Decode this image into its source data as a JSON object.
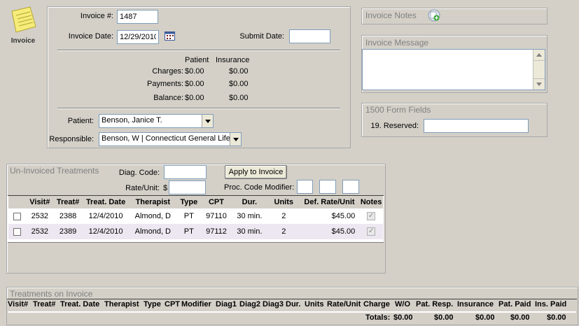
{
  "nav": {
    "invoice_label": "Invoice"
  },
  "invoice": {
    "number_label": "Invoice #:",
    "number_value": "1487",
    "date_label": "Invoice Date:",
    "date_value": "12/29/2010",
    "submit_label": "Submit Date:",
    "submit_value": ""
  },
  "summary": {
    "col_patient": "Patient",
    "col_insurance": "Insurance",
    "rows": [
      {
        "label": "Charges:",
        "patient": "$0.00",
        "insurance": "$0.00"
      },
      {
        "label": "Payments:",
        "patient": "$0.00",
        "insurance": "$0.00"
      },
      {
        "label": "Balance:",
        "patient": "$0.00",
        "insurance": "$0.00"
      }
    ]
  },
  "patient": {
    "label": "Patient:",
    "value": "Benson, Janice T.",
    "responsible_label": "Responsible:",
    "responsible_value": "Benson, W | Connecticut General Life"
  },
  "notes": {
    "title": "Invoice Notes"
  },
  "message": {
    "title": "Invoice Message",
    "value": ""
  },
  "form1500": {
    "title": "1500 Form Fields",
    "reserved_label": "19. Reserved:",
    "reserved_value": ""
  },
  "uninvoiced": {
    "title": "Un-Invoiced Treatments",
    "diag_label": "Diag. Code:",
    "diag_value": "",
    "rate_label": "Rate/Unit:",
    "rate_prefix": "$",
    "rate_value": "",
    "apply_label": "Apply to Invoice",
    "modifier_label": "Proc. Code Modifier:",
    "columns": [
      "Visit#",
      "Treat#",
      "Treat. Date",
      "Therapist",
      "Type",
      "CPT",
      "Dur.",
      "Units",
      "Def. Rate/Unit",
      "Notes"
    ],
    "rows": [
      {
        "visit": "2532",
        "treat": "2388",
        "date": "12/4/2010",
        "therapist": "Almond, D",
        "type": "PT",
        "cpt": "97110",
        "dur": "30 min.",
        "units": "2",
        "rate": "$45.00"
      },
      {
        "visit": "2532",
        "treat": "2389",
        "date": "12/4/2010",
        "therapist": "Almond, D",
        "type": "PT",
        "cpt": "97112",
        "dur": "30 min.",
        "units": "2",
        "rate": "$45.00"
      }
    ]
  },
  "oninvoice": {
    "title": "Treatments on Invoice",
    "columns": [
      "Visit#",
      "Treat#",
      "Treat. Date",
      "Therapist",
      "Type",
      "CPT",
      "Modifier",
      "Diag1",
      "Diag2",
      "Diag3",
      "Dur.",
      "Units",
      "Rate/Unit",
      "Charge",
      "W/O",
      "Pat. Resp.",
      "Insurance",
      "Pat. Paid",
      "Ins. Paid"
    ],
    "totals_label": "Totals:",
    "totals": [
      "$0.00",
      "$0.00",
      "$0.00",
      "$0.00",
      "$0.00",
      "$0.00"
    ]
  }
}
